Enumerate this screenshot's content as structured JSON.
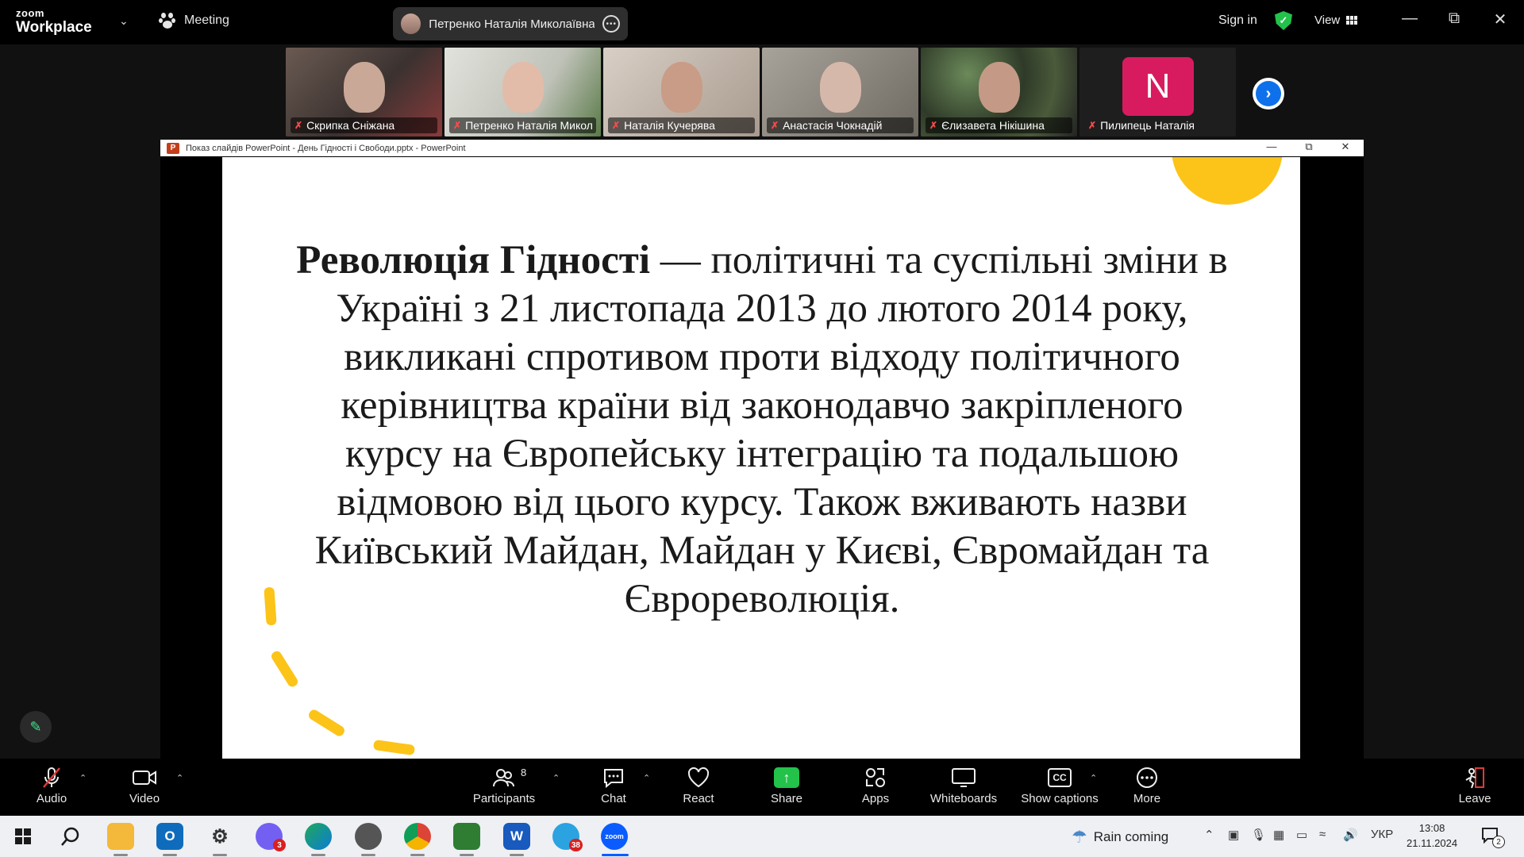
{
  "topbar": {
    "brand_small": "zoom",
    "brand_large": "Workplace",
    "meeting_label": "Meeting",
    "active_speaker": "Петренко Наталія Миколаївна",
    "signin_label": "Sign in",
    "view_label": "View",
    "shield_color": "#23c24a"
  },
  "participants": [
    {
      "name": "Скрипка Сніжана",
      "muted": true
    },
    {
      "name": "Петренко Наталія Миколаївна",
      "muted": true,
      "active": true
    },
    {
      "name": "Наталія Кучерява",
      "muted": true
    },
    {
      "name": "Анастасія Чокнадій",
      "muted": true
    },
    {
      "name": "Єлизавета Нікішина",
      "muted": true
    },
    {
      "name": "Пилипець Наталія",
      "muted": true,
      "initial": "N",
      "avatar_color": "#d81b5f"
    }
  ],
  "ppt_window": {
    "title": "Показ слайдів PowerPoint  -  День Гідності і Свободи.pptx - PowerPoint"
  },
  "slide": {
    "title_bold": "Революція Гідності",
    "body": " — політичні та суспільні зміни в Україні з 21 листопада 2013 до лютого 2014 року, викликані спротивом проти відходу політичного керівництва країни від законодавчо закріпленого курсу на Європейську інтеграцію та подальшою відмовою від цього курсу. Також вживають назви Київський Майдан, Майдан у Києві, Євромайдан та Єврореволюція.",
    "accent_color": "#fcc419"
  },
  "toolbar": {
    "audio": "Audio",
    "video": "Video",
    "participants": "Participants",
    "participants_count": "8",
    "chat": "Chat",
    "react": "React",
    "share": "Share",
    "apps": "Apps",
    "whiteboards": "Whiteboards",
    "captions": "Show captions",
    "captions_icon": "CC",
    "more": "More",
    "leave": "Leave",
    "share_color": "#23c24a"
  },
  "taskbar": {
    "weather": "Rain coming",
    "language": "УКР",
    "time": "13:08",
    "date": "21.11.2024",
    "viber_badge": "3",
    "telegram_badge": "38",
    "notif_count": "2",
    "word_icon": "W",
    "outlook_icon": "O",
    "zoom_icon": "zoom"
  }
}
